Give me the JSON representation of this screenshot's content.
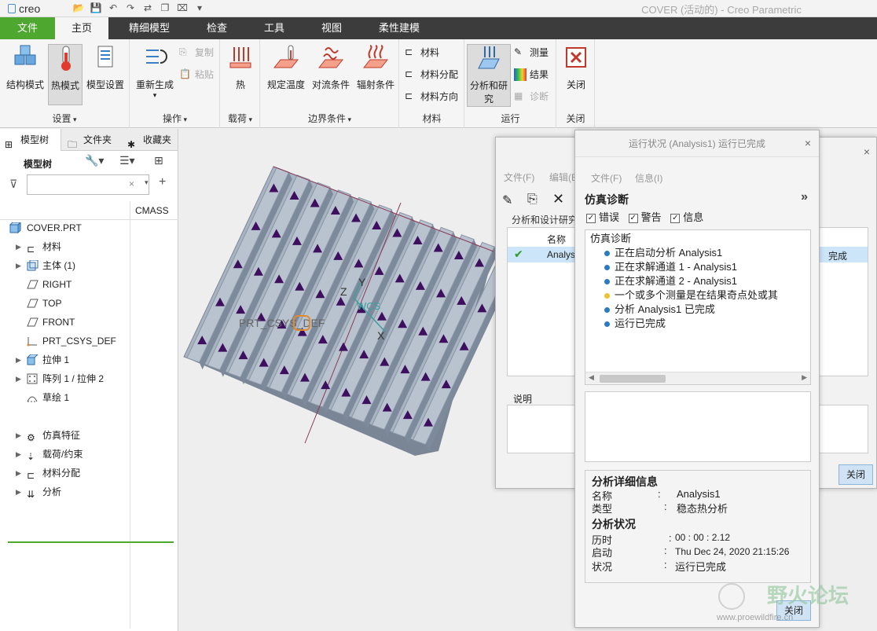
{
  "app": {
    "logo": "creo",
    "window_title": "COVER (活动的) - Creo Parametric"
  },
  "ribbon": {
    "tabs": [
      "文件",
      "主页",
      "精细模型",
      "检查",
      "工具",
      "视图",
      "柔性建模"
    ],
    "groups": {
      "setup": {
        "label": "设置",
        "structural_mode": "结构模式",
        "thermal_mode": "热模式",
        "model_setup": "模型设置"
      },
      "operations": {
        "label": "操作",
        "regenerate": "重新生成",
        "copy": "复制",
        "paste": "粘贴"
      },
      "loads": {
        "label": "载荷",
        "heat": "热"
      },
      "boundary": {
        "label": "边界条件",
        "prescribed_temp": "规定温度",
        "convection": "对流条件",
        "radiation": "辐射条件"
      },
      "materials": {
        "label": "材料",
        "material": "材料",
        "material_assignment": "材料分配",
        "material_orientation": "材料方向"
      },
      "run": {
        "label": "运行",
        "analyses_studies": "分析和研究",
        "measure": "测量",
        "results": "结果",
        "diagnostics": "诊断"
      },
      "close": {
        "label": "关闭",
        "close": "关闭"
      }
    },
    "colors": {
      "file_tab": "#4ea72e",
      "tabbar": "#3c3c3c"
    }
  },
  "left_panel": {
    "tabs": [
      "模型树",
      "文件夹",
      "收藏夹"
    ],
    "tree_header": "模型树",
    "filter_placeholder": "",
    "column": "CMASS",
    "items": [
      {
        "label": "COVER.PRT",
        "icon": "part-icon"
      },
      {
        "label": "材料",
        "icon": "material-icon"
      },
      {
        "label": "主体 (1)",
        "icon": "body-icon"
      },
      {
        "label": "RIGHT",
        "icon": "datum-plane-icon"
      },
      {
        "label": "TOP",
        "icon": "datum-plane-icon"
      },
      {
        "label": "FRONT",
        "icon": "datum-plane-icon"
      },
      {
        "label": "PRT_CSYS_DEF",
        "icon": "csys-icon"
      },
      {
        "label": "拉伸 1",
        "icon": "extrude-icon"
      },
      {
        "label": "阵列 1 / 拉伸 2",
        "icon": "pattern-icon"
      },
      {
        "label": "草绘 1",
        "icon": "sketch-icon"
      },
      {
        "label": "仿真特征",
        "icon": "simulation-icon"
      },
      {
        "label": "载荷/约束",
        "icon": "load-icon"
      },
      {
        "label": "材料分配",
        "icon": "material-assign-icon"
      },
      {
        "label": "分析",
        "icon": "analysis-icon"
      }
    ]
  },
  "viewport": {
    "labels": {
      "csys": "PRT_CSYS_DEF",
      "wcs": "WCS",
      "x": "X",
      "y": "Y",
      "z": "Z"
    }
  },
  "analysis_dialog": {
    "menus": [
      "文件(F)",
      "编辑(E)"
    ],
    "panel_title": "分析和设计研究",
    "col_name": "名称",
    "row_name": "Analysis1",
    "row_status": "完成",
    "desc_label": "说明",
    "close": "关闭"
  },
  "run_dialog": {
    "title": "运行状况 (Analysis1) 运行已完成",
    "menus": [
      "文件(F)",
      "信息(I)"
    ],
    "diag_title": "仿真诊断",
    "filters": [
      "错误",
      "警告",
      "信息"
    ],
    "diag_root": "仿真诊断",
    "diag_lines": [
      {
        "text": "正在启动分析 Analysis1",
        "color": "#2a7bc0"
      },
      {
        "text": "正在求解通道 1 - Analysis1",
        "color": "#2a7bc0"
      },
      {
        "text": "正在求解通道 2 - Analysis1",
        "color": "#2a7bc0"
      },
      {
        "text": "一个或多个测量是在结果奇点处或其",
        "color": "#f2c12e"
      },
      {
        "text": "分析 Analysis1 已完成",
        "color": "#2a7bc0"
      },
      {
        "text": "运行已完成",
        "color": "#2a7bc0"
      }
    ],
    "details": {
      "title": "分析详细信息",
      "name_label": "名称",
      "name_value": "Analysis1",
      "type_label": "类型",
      "type_value": "稳态热分析",
      "status_title": "分析状况",
      "elapsed_label": "历时",
      "elapsed_value": "00 : 00 : 2.12",
      "start_label": "启动",
      "start_value": "Thu Dec 24, 2020    21:15:26",
      "state_label": "状况",
      "state_value": "运行已完成"
    },
    "close": "关闭"
  },
  "watermark": {
    "title": "野火论坛",
    "url": "www.proewildfire.cn"
  }
}
